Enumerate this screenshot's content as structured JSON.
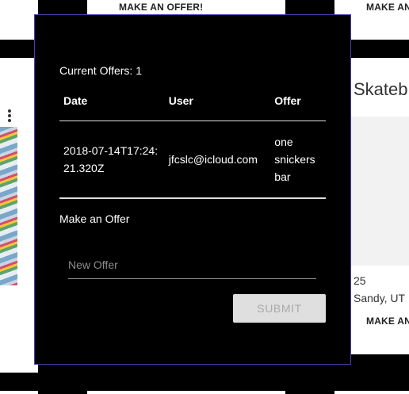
{
  "background_cards": {
    "top_center_action": "MAKE AN OFFER!",
    "top_right_action": "MAKE AN",
    "right_title": "Skateb",
    "right_price": "25",
    "right_location": "Sandy, UT",
    "right_action": "MAKE AN"
  },
  "modal": {
    "offers_count": "Current Offers: 1",
    "table": {
      "headers": [
        "Date",
        "User",
        "Offer"
      ],
      "rows": [
        [
          "2018-07-14T17:24:21.320Z",
          "jfcslc@icloud.com",
          "one snickers bar"
        ]
      ]
    },
    "make_offer_label": "Make an Offer",
    "input_placeholder": "New Offer",
    "submit_label": "SUBMIT"
  },
  "colors": {
    "modal_border": "#4a3fb0",
    "submit_disabled_bg": "#dfdfdf",
    "submit_disabled_text": "#a9a9a9"
  }
}
